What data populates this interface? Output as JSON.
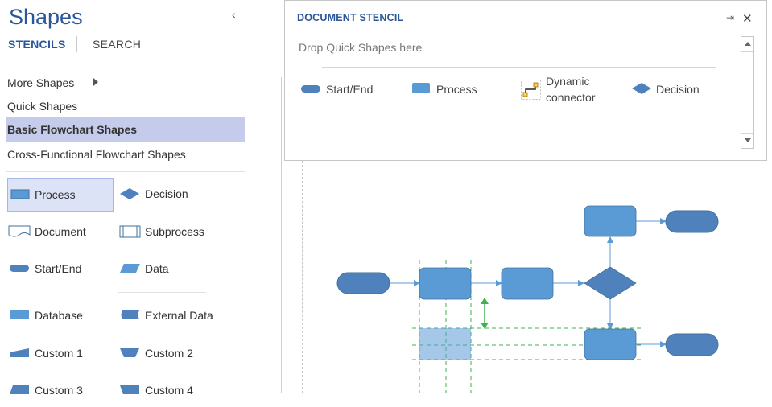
{
  "shapes_pane": {
    "title": "Shapes",
    "tabs": {
      "stencils": "STENCILS",
      "search": "SEARCH"
    },
    "nav": {
      "more_shapes": "More Shapes",
      "quick_shapes": "Quick Shapes",
      "basic_flowchart": "Basic Flowchart Shapes",
      "cross_functional": "Cross-Functional Flowchart Shapes"
    },
    "shape_items": {
      "process": "Process",
      "decision": "Decision",
      "document": "Document",
      "subprocess": "Subprocess",
      "start_end": "Start/End",
      "data": "Data",
      "database": "Database",
      "external_data": "External Data",
      "custom1": "Custom 1",
      "custom2": "Custom 2",
      "custom3": "Custom 3",
      "custom4": "Custom 4"
    },
    "selected_nav": "Basic Flowchart Shapes",
    "selected_shape": "Process"
  },
  "document_stencil": {
    "title": "DOCUMENT STENCIL",
    "drop_hint": "Drop Quick Shapes here",
    "items": {
      "start_end": "Start/End",
      "process": "Process",
      "dynamic_connector_line1": "Dynamic",
      "dynamic_connector_line2": "connector",
      "decision": "Decision"
    }
  },
  "colors": {
    "accent": "#2b579a",
    "shape_fill": "#5b9bd5",
    "terminator_fill": "#4f81bd",
    "guide_green": "#3cb44b",
    "selection_bg": "#c5cbea"
  }
}
